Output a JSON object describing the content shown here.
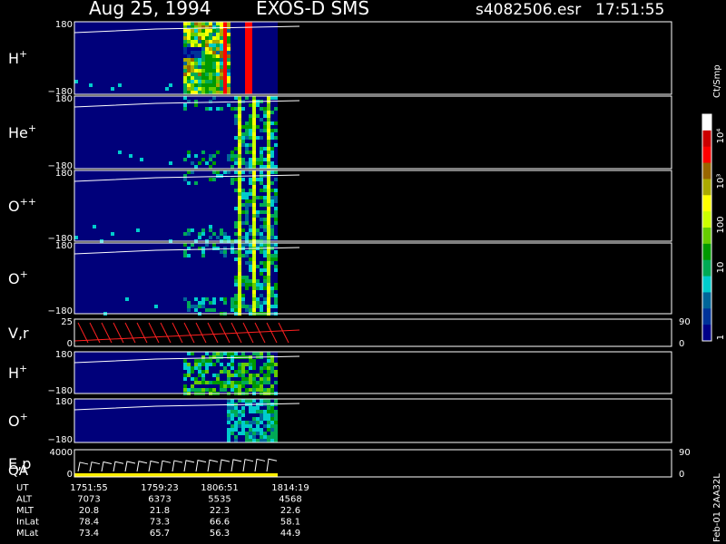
{
  "header": {
    "date": "Aug 25, 1994",
    "instrument": "EXOS-D SMS",
    "file": "s4082506.esr",
    "time": "17:51:55"
  },
  "colorbar": {
    "unit": "Ct/Smp",
    "tick_labels": [
      "10⁴",
      "10³",
      "100",
      "10",
      "1"
    ],
    "colors": [
      "#ffffff",
      "#cc0000",
      "#ff0000",
      "#996600",
      "#aaaa00",
      "#ffff00",
      "#ccff00",
      "#66cc00",
      "#009900",
      "#00aa55",
      "#00cccc",
      "#006699",
      "#003399",
      "#000088"
    ]
  },
  "footer": {
    "rotated_label": "Feb-01 2AA32L",
    "rows": [
      {
        "label": "UT",
        "values": [
          "1751:55",
          "1759:23",
          "1806:51",
          "1814:19"
        ]
      },
      {
        "label": "ALT",
        "values": [
          "7073",
          "6373",
          "5535",
          "4568"
        ]
      },
      {
        "label": "MLT",
        "values": [
          "20.8",
          "21.8",
          "22.3",
          "22.6"
        ]
      },
      {
        "label": "InLat",
        "values": [
          "78.4",
          "73.3",
          "66.6",
          "58.1"
        ]
      },
      {
        "label": "MLat",
        "values": [
          "73.4",
          "65.7",
          "56.3",
          "44.9"
        ]
      }
    ]
  },
  "chart_data": [
    {
      "type": "heatmap",
      "panel": "H+",
      "label": "H",
      "sup": "+",
      "ylim": [
        -180,
        180
      ],
      "tick_labels": [
        "180",
        "−180"
      ]
    },
    {
      "type": "heatmap",
      "panel": "He+",
      "label": "He",
      "sup": "+",
      "ylim": [
        -180,
        180
      ],
      "tick_labels": [
        "180",
        "−180"
      ]
    },
    {
      "type": "heatmap",
      "panel": "O++",
      "label": "O",
      "sup": "++",
      "ylim": [
        -180,
        180
      ],
      "tick_labels": [
        "180",
        "−180"
      ]
    },
    {
      "type": "heatmap",
      "panel": "O+",
      "label": "O",
      "sup": "+",
      "ylim": [
        -180,
        180
      ],
      "tick_labels": [
        "180",
        "−180"
      ]
    },
    {
      "type": "line",
      "panel": "V,r",
      "label": "V,r",
      "sup": "",
      "ylim": [
        0,
        25
      ],
      "tick_labels": [
        "25",
        "0"
      ],
      "right_tick_labels": [
        "90",
        "0"
      ],
      "color": "#ff2020"
    },
    {
      "type": "heatmap",
      "panel": "H+ (2)",
      "label": "H",
      "sup": "+",
      "ylim": [
        -180,
        180
      ],
      "tick_labels": [
        "180",
        "−180"
      ]
    },
    {
      "type": "heatmap",
      "panel": "O+ (2)",
      "label": "O",
      "sup": "+",
      "ylim": [
        -180,
        180
      ],
      "tick_labels": [
        "180",
        "−180"
      ]
    },
    {
      "type": "line",
      "panel": "E,p / QA",
      "label": "E,p",
      "label2": "QA",
      "sup": "",
      "ylim": [
        0,
        4000
      ],
      "tick_labels": [
        "4000",
        "0"
      ],
      "right_tick_labels": [
        "90",
        "0"
      ],
      "color": "#ffffff",
      "qa_color": "#ffee00"
    }
  ]
}
